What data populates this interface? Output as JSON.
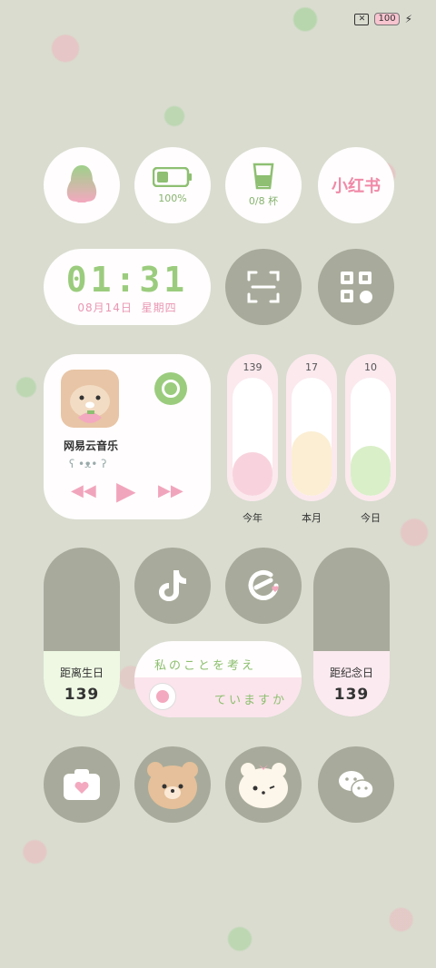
{
  "status_bar": {
    "battery": "100"
  },
  "widgets": {
    "battery": {
      "label": "100%"
    },
    "water": {
      "label": "0/8 杯"
    },
    "xiaohongshu": {
      "label": "小红书"
    },
    "clock": {
      "time": "01:31",
      "date": "08月14日",
      "weekday": "星期四"
    },
    "music": {
      "title": "网易云音乐"
    },
    "progress": [
      {
        "value": "139",
        "label": "今年",
        "fraction": 0.37,
        "color": "#f8d3dd"
      },
      {
        "value": "17",
        "label": "本月",
        "fraction": 0.55,
        "color": "#fbeed3"
      },
      {
        "value": "10",
        "label": "今日",
        "fraction": 0.42,
        "color": "#d9efc8"
      }
    ],
    "birthday": {
      "label": "距离生日",
      "days": "139"
    },
    "anniversary": {
      "label": "距纪念日",
      "days": "139"
    },
    "quote": {
      "line1": "私のことを考え",
      "line2": "ていますか"
    }
  },
  "colors": {
    "accent_green": "#9bcc7e",
    "accent_pink": "#e996b3",
    "widget_grey": "#a8ab9b"
  }
}
